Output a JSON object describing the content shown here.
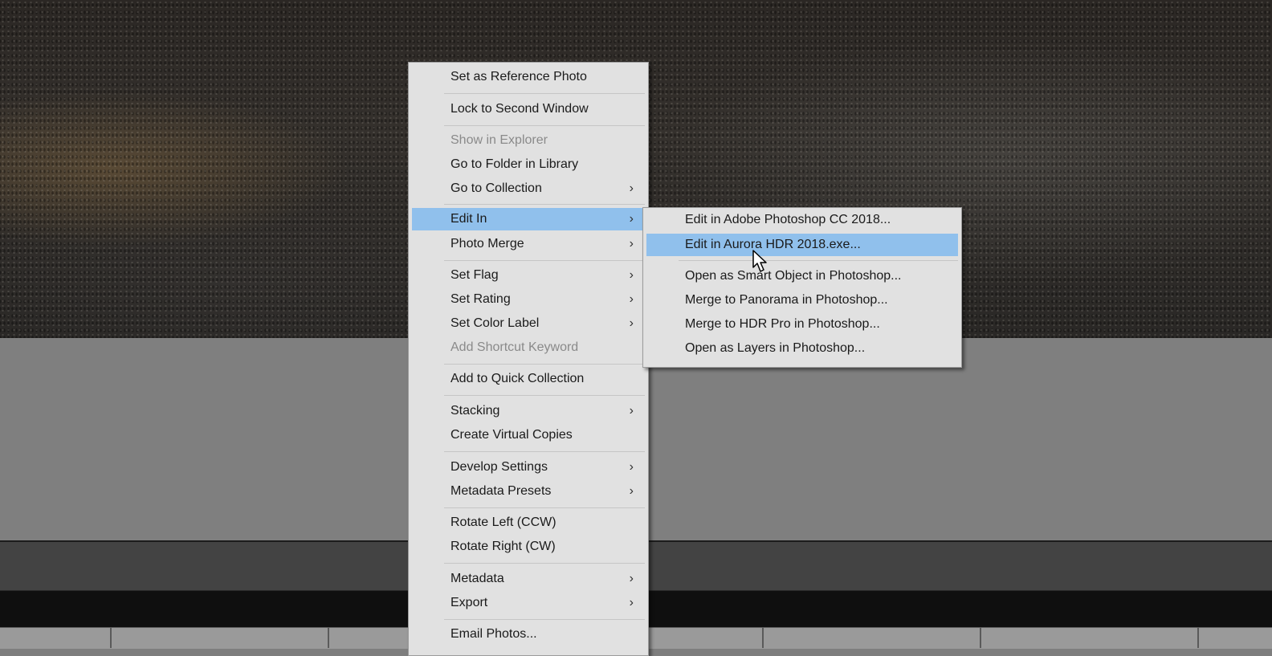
{
  "context_menu": {
    "items": [
      {
        "label": "Set as Reference Photo",
        "disabled": false,
        "submenu": false
      },
      {
        "label": "Lock to Second Window",
        "disabled": false,
        "submenu": false
      },
      {
        "label": "Show in Explorer",
        "disabled": true,
        "submenu": false
      },
      {
        "label": "Go to Folder in Library",
        "disabled": false,
        "submenu": false
      },
      {
        "label": "Go to Collection",
        "disabled": false,
        "submenu": true
      },
      {
        "label": "Edit In",
        "disabled": false,
        "submenu": true,
        "highlighted": true
      },
      {
        "label": "Photo Merge",
        "disabled": false,
        "submenu": true
      },
      {
        "label": "Set Flag",
        "disabled": false,
        "submenu": true
      },
      {
        "label": "Set Rating",
        "disabled": false,
        "submenu": true
      },
      {
        "label": "Set Color Label",
        "disabled": false,
        "submenu": true
      },
      {
        "label": "Add Shortcut Keyword",
        "disabled": true,
        "submenu": false
      },
      {
        "label": "Add to Quick Collection",
        "disabled": false,
        "submenu": false
      },
      {
        "label": "Stacking",
        "disabled": false,
        "submenu": true
      },
      {
        "label": "Create Virtual Copies",
        "disabled": false,
        "submenu": false
      },
      {
        "label": "Develop Settings",
        "disabled": false,
        "submenu": true
      },
      {
        "label": "Metadata Presets",
        "disabled": false,
        "submenu": true
      },
      {
        "label": "Rotate Left (CCW)",
        "disabled": false,
        "submenu": false
      },
      {
        "label": "Rotate Right (CW)",
        "disabled": false,
        "submenu": false
      },
      {
        "label": "Metadata",
        "disabled": false,
        "submenu": true
      },
      {
        "label": "Export",
        "disabled": false,
        "submenu": true
      },
      {
        "label": "Email Photos...",
        "disabled": false,
        "submenu": false
      }
    ],
    "submenu_chevron": "›"
  },
  "edit_in_submenu": {
    "items": [
      {
        "label": "Edit in Adobe Photoshop CC 2018..."
      },
      {
        "label": "Edit in Aurora HDR 2018.exe...",
        "highlighted": true
      },
      {
        "label": "Open as Smart Object in Photoshop..."
      },
      {
        "label": "Merge to Panorama in Photoshop..."
      },
      {
        "label": "Merge to HDR Pro in Photoshop..."
      },
      {
        "label": "Open as Layers in Photoshop..."
      }
    ]
  },
  "colors": {
    "menu_bg": "#e1e1e1",
    "highlight": "#90c0ec",
    "disabled_text": "#8a8a8a"
  },
  "icons": {
    "cursor": "arrow-pointer-icon",
    "submenu_arrow": "chevron-right-icon"
  }
}
